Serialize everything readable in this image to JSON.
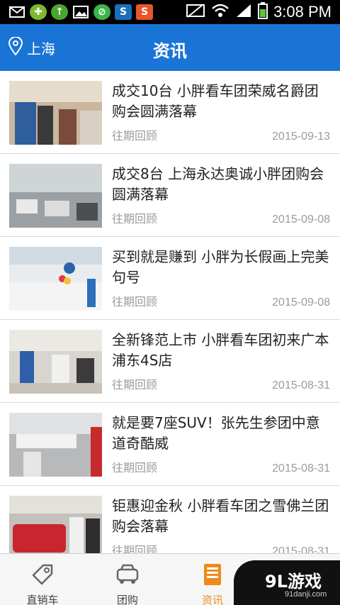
{
  "status_bar": {
    "time": "3:08 PM"
  },
  "header": {
    "location": "上海",
    "title": "资讯"
  },
  "news": [
    {
      "title": "成交10台 小胖看车团荣威名爵团购会圆满落幕",
      "tag": "往期回顾",
      "date": "2015-09-13"
    },
    {
      "title": "成交8台 上海永达奥诚小胖团购会圆满落幕",
      "tag": "往期回顾",
      "date": "2015-09-08"
    },
    {
      "title": "买到就是赚到 小胖为长假画上完美句号",
      "tag": "往期回顾",
      "date": "2015-09-08"
    },
    {
      "title": "全新锋范上市 小胖看车团初来广本浦东4S店",
      "tag": "往期回顾",
      "date": "2015-08-31"
    },
    {
      "title": "就是要7座SUV！张先生参团中意道奇酷威",
      "tag": "往期回顾",
      "date": "2015-08-31"
    },
    {
      "title": "钜惠迎金秋 小胖看车团之雪佛兰团购会落幕",
      "tag": "往期回顾",
      "date": "2015-08-31"
    }
  ],
  "bottom_nav": [
    {
      "label": "直销车",
      "icon": "tag-icon"
    },
    {
      "label": "团购",
      "icon": "car-icon"
    },
    {
      "label": "资讯",
      "icon": "news-icon",
      "active": true
    },
    {
      "label": "",
      "icon": "profile-icon"
    }
  ],
  "watermark": {
    "brand": "9L游戏",
    "site": "91danji.com"
  },
  "colors": {
    "header": "#1a74d6",
    "active_tab": "#f08a1c"
  }
}
